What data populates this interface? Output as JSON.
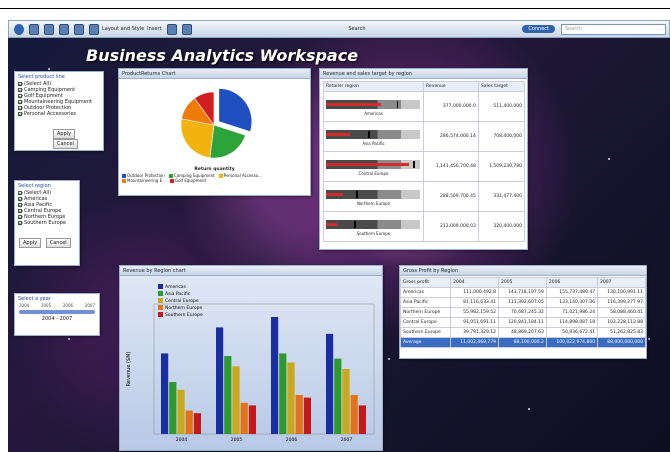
{
  "toolbar": {
    "menu1": "Layout and Style",
    "menu2": "Insert",
    "menu3": "",
    "menu4": "",
    "mid_label": "Search",
    "connect": "Connect",
    "search_placeholder": "Search"
  },
  "workspace_title": "Business Analytics Workspace",
  "product_filter": {
    "title": "Select product line",
    "items": [
      "(Select All)",
      "Camping Equipment",
      "Golf Equipment",
      "Mountaineering Equipment",
      "Outdoor Protection",
      "Personal Accessories"
    ],
    "apply": "Apply",
    "cancel": "Cancel"
  },
  "region_filter": {
    "title": "Select region",
    "items": [
      "(Select All)",
      "Americas",
      "Asia Pacific",
      "Central Europe",
      "Northern Europe",
      "Southern Europe"
    ],
    "apply": "Apply",
    "cancel": "Cancel"
  },
  "year_filter": {
    "title": "Select a year",
    "ticks": [
      "2004",
      "2005",
      "2006",
      "2007"
    ],
    "range": "2004 - 2007"
  },
  "pie_panel": {
    "title": "ProductReturns Chart",
    "axis_label": "Return quantity",
    "legend": [
      "Outdoor Protection",
      "Camping Equipment",
      "Personal Accesso...",
      "Mountaineering E...",
      "Golf Equipment"
    ],
    "colors": [
      "#1f4fbf",
      "#2ea33a",
      "#f2b20f",
      "#f07a0a",
      "#d11f1f"
    ],
    "values": [
      30,
      22,
      26,
      12,
      10
    ]
  },
  "bullet_panel": {
    "title": "Revenue and sales target by region",
    "headers": [
      "Retailer region",
      "Revenue",
      "Sales target"
    ],
    "rows": [
      {
        "region": "Americas",
        "revenue": "377,000,000.0",
        "target": "511,400,000",
        "value": 0.58,
        "target_pos": 0.75
      },
      {
        "region": "Asia Pacific",
        "revenue": "286,574,000.14",
        "target": "708,400,000",
        "value": 0.25,
        "target_pos": 0.45
      },
      {
        "region": "Central Europe",
        "revenue": "1,141,450,700.48",
        "target": "1,509,230,780",
        "value": 0.88,
        "target_pos": 0.93
      },
      {
        "region": "Northern Europe",
        "revenue": "288,509,700.45",
        "target": "331,477,400",
        "value": 0.18,
        "target_pos": 0.32
      },
      {
        "region": "Southern Europe",
        "revenue": "212,009,000.03",
        "target": "320,400,000",
        "value": 0.12,
        "target_pos": 0.3
      }
    ]
  },
  "bar_panel": {
    "title": "Revenue by Region chart",
    "ylabel": "Revenue ($M)",
    "legend": [
      "Americas",
      "Asia Pacific",
      "Central Europe",
      "Northern Europe",
      "Southern Europe"
    ],
    "colors": [
      "#1a2ea3",
      "#2e9a2e",
      "#c9a81d",
      "#e2731a",
      "#c21a1a"
    ],
    "chart_data": {
      "type": "bar",
      "categories": [
        "2004",
        "2005",
        "2006",
        "2007"
      ],
      "series": [
        {
          "name": "Americas",
          "values": [
            62,
            82,
            90,
            77
          ]
        },
        {
          "name": "Asia Pacific",
          "values": [
            40,
            60,
            62,
            58
          ]
        },
        {
          "name": "Central Europe",
          "values": [
            34,
            52,
            55,
            50
          ]
        },
        {
          "name": "Northern Europe",
          "values": [
            18,
            24,
            30,
            30
          ]
        },
        {
          "name": "Southern Europe",
          "values": [
            16,
            22,
            28,
            22
          ]
        }
      ],
      "ylim": [
        0,
        100
      ]
    }
  },
  "table_panel": {
    "title": "Gross Profit by Region",
    "headers": [
      "Gross profit",
      "2004",
      "2005",
      "2006",
      "2007"
    ],
    "rows": [
      [
        "Americas",
        "111,000,492.8",
        "143,718,197.59",
        "155,737,489.47",
        "130,100,991.11"
      ],
      [
        "Asia Pacific",
        "81,116,633.41",
        "111,392,607.05",
        "133,140,307.06",
        "116,399,277.97"
      ],
      [
        "Northern Europe",
        "55,982,159.52",
        "70,687,245.32",
        "71,021,986.24",
        "58,088,460.41"
      ],
      [
        "Central Europe",
        "91,051,691.11",
        "120,841,184.11",
        "114,898,087.18",
        "103,228,113.88"
      ],
      [
        "Southern Europe",
        "39,791,329.12",
        "48,869,207.63",
        "50,936,672.41",
        "51,262,825.83"
      ],
      [
        "Average",
        "11,002,469,779",
        "88,100,000.2",
        "100,022,974,800",
        "88,000,000,000"
      ]
    ]
  }
}
